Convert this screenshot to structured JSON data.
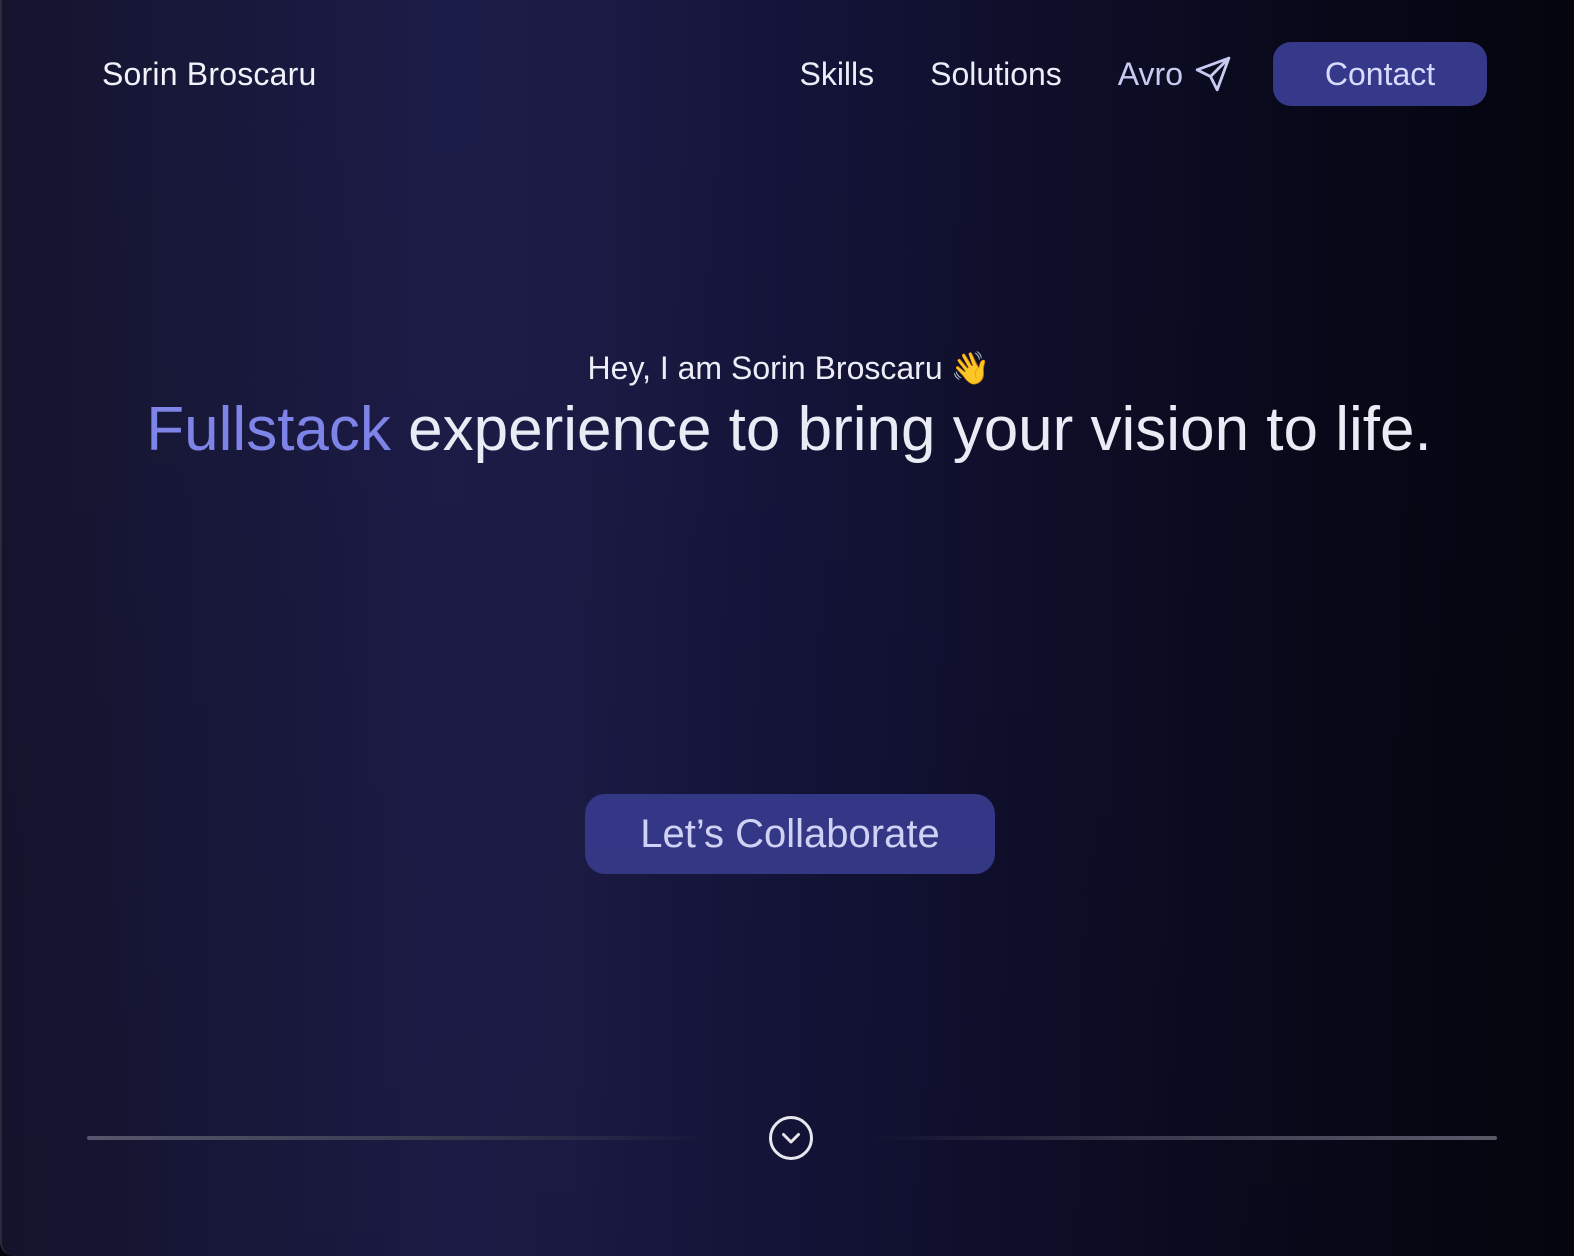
{
  "header": {
    "brand": "Sorin Broscaru",
    "nav": {
      "skills": "Skills",
      "solutions": "Solutions",
      "avro": "Avro",
      "contact": "Contact"
    }
  },
  "hero": {
    "greeting": "Hey, I am Sorin Broscaru",
    "greeting_emoji": "👋",
    "headline_accent": "Fullstack",
    "headline_rest": "experience to bring your vision to life.",
    "cta": "Let’s Collaborate"
  },
  "icons": {
    "avro": "send-icon",
    "greeting": "waving-hand-icon",
    "scroll": "chevron-down-circle-icon"
  },
  "colors": {
    "accent": "#8187ec",
    "button_bg": "#36398a",
    "button_text": "#d8dbff"
  }
}
